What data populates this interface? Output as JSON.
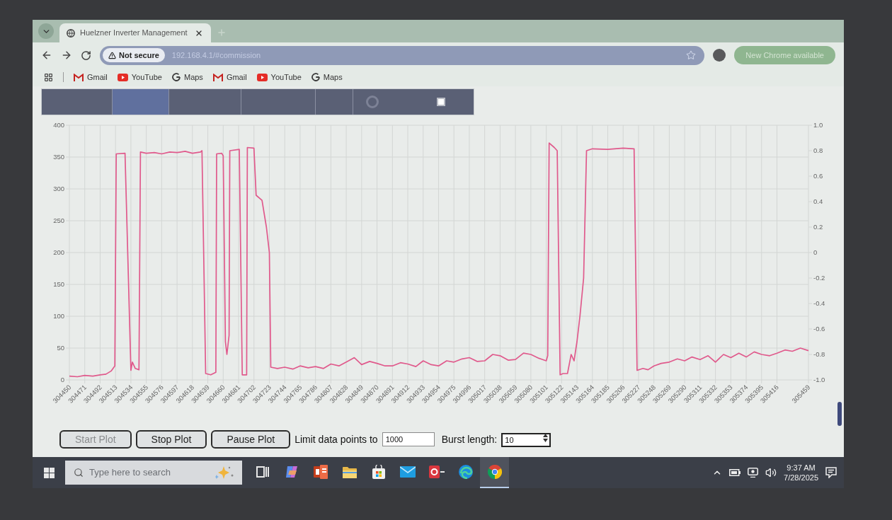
{
  "browser": {
    "tabs": [
      {
        "title": "Huelzner Inverter Management",
        "selected": true
      }
    ],
    "address_bar": {
      "security_label": "Not secure",
      "url": "192.168.4.1/#commission"
    },
    "update_button": "New Chrome available",
    "bookmarks": [
      {
        "kind": "gmail",
        "label": "Gmail"
      },
      {
        "kind": "youtube",
        "label": "YouTube"
      },
      {
        "kind": "google",
        "label": "Maps"
      },
      {
        "kind": "gmail",
        "label": "Gmail"
      },
      {
        "kind": "youtube",
        "label": "YouTube"
      },
      {
        "kind": "google",
        "label": "Maps"
      }
    ]
  },
  "app": {
    "nav_tabs": [
      {
        "kind": "plain",
        "selected": false
      },
      {
        "kind": "plain",
        "selected": true
      },
      {
        "kind": "plain",
        "selected": false
      },
      {
        "kind": "plain",
        "selected": false
      },
      {
        "kind": "plain",
        "selected": false
      },
      {
        "kind": "loading",
        "selected": false
      }
    ],
    "checkbox": {
      "checked": false
    },
    "chart_data": {
      "type": "line",
      "grid": true,
      "x": [
        304450,
        304461,
        304471,
        304482,
        304492,
        304500,
        304507,
        304512,
        304514,
        304526,
        304534,
        304536,
        304540,
        304545,
        304547,
        304555,
        304566,
        304576,
        304587,
        304597,
        304608,
        304618,
        304629,
        304631,
        304636,
        304643,
        304650,
        304651,
        304658,
        304660,
        304663,
        304665,
        304668,
        304669,
        304682,
        304686,
        304692,
        304693,
        304702,
        304705,
        304713,
        304719,
        304723,
        304725,
        304734,
        304744,
        304755,
        304765,
        304776,
        304786,
        304797,
        304807,
        304818,
        304828,
        304839,
        304849,
        304860,
        304870,
        304881,
        304891,
        304902,
        304912,
        304923,
        304933,
        304944,
        304954,
        304965,
        304975,
        304986,
        304996,
        305007,
        305017,
        305028,
        305038,
        305049,
        305059,
        305070,
        305080,
        305091,
        305101,
        305103,
        305105,
        305112,
        305116,
        305120,
        305124,
        305130,
        305135,
        305139,
        305143,
        305147,
        305152,
        305156,
        305164,
        305185,
        305206,
        305221,
        305225,
        305233,
        305240,
        305248,
        305258,
        305269,
        305280,
        305290,
        305300,
        305311,
        305322,
        305332,
        305343,
        305353,
        305364,
        305374,
        305385,
        305395,
        305406,
        305416,
        305427,
        305437,
        305448,
        305459
      ],
      "series": [
        {
          "color": "#e05a8c",
          "values": [
            6,
            5,
            7,
            6,
            8,
            9,
            14,
            22,
            355,
            356,
            15,
            28,
            18,
            16,
            358,
            356,
            357,
            355,
            358,
            357,
            359,
            356,
            358,
            360,
            10,
            8,
            12,
            355,
            356,
            352,
            60,
            40,
            70,
            360,
            362,
            8,
            8,
            365,
            364,
            290,
            282,
            240,
            200,
            20,
            18,
            20,
            17,
            22,
            19,
            21,
            18,
            25,
            22,
            28,
            35,
            24,
            29,
            26,
            22,
            22,
            27,
            25,
            21,
            30,
            24,
            22,
            30,
            28,
            33,
            35,
            29,
            30,
            40,
            38,
            31,
            32,
            42,
            40,
            34,
            30,
            38,
            372,
            365,
            360,
            8,
            10,
            10,
            40,
            30,
            60,
            100,
            160,
            360,
            363,
            362,
            364,
            363,
            15,
            18,
            16,
            22,
            26,
            28,
            33,
            30,
            36,
            32,
            38,
            28,
            40,
            35,
            42,
            36,
            44,
            40,
            38,
            42,
            47,
            45,
            50,
            46
          ]
        }
      ],
      "xlim": [
        304450,
        305459
      ],
      "ylim": [
        0,
        400
      ],
      "xticks": [
        304450,
        304471,
        304492,
        304513,
        304534,
        304555,
        304576,
        304597,
        304618,
        304639,
        304660,
        304681,
        304702,
        304723,
        304744,
        304765,
        304786,
        304807,
        304828,
        304849,
        304870,
        304891,
        304912,
        304933,
        304954,
        304975,
        304996,
        305017,
        305038,
        305059,
        305080,
        305101,
        305122,
        305143,
        305164,
        305185,
        305206,
        305227,
        305248,
        305269,
        305290,
        305311,
        305332,
        305353,
        305374,
        305395,
        305416,
        305459
      ],
      "yticks": [
        0,
        50,
        100,
        150,
        200,
        250,
        300,
        350,
        400
      ],
      "y2lim": [
        -1,
        1
      ],
      "y2ticks": [
        {
          "value": 1,
          "label": "1.0"
        },
        {
          "value": 0.8,
          "label": "0.8"
        },
        {
          "value": 0.6,
          "label": "0.6"
        },
        {
          "value": 0.4,
          "label": "0.4"
        },
        {
          "value": 0.2,
          "label": "0.2"
        },
        {
          "value": 0,
          "label": "0"
        },
        {
          "value": -0.2,
          "label": "-0.2"
        },
        {
          "value": -0.4,
          "label": "-0.4"
        },
        {
          "value": -0.6,
          "label": "-0.6"
        },
        {
          "value": -0.8,
          "label": "-0.8"
        },
        {
          "value": -1,
          "label": "-1.0"
        }
      ]
    },
    "buttons": [
      {
        "label": "Start Plot",
        "disabled": true
      },
      {
        "label": "Stop Plot",
        "disabled": false
      },
      {
        "label": "Pause Plot",
        "disabled": false
      }
    ],
    "limit_field": {
      "label": "Limit data points to",
      "value": "1000"
    },
    "burst_field": {
      "label": "Burst length:",
      "value": "10"
    }
  },
  "taskbar": {
    "search": {
      "placeholder": "Type here to search"
    },
    "apps": [
      {
        "kind": "taskview",
        "active": false
      },
      {
        "kind": "copilot",
        "active": false
      },
      {
        "kind": "powerpoint",
        "active": false
      },
      {
        "kind": "explorer",
        "active": false
      },
      {
        "kind": "store",
        "active": false
      },
      {
        "kind": "mail",
        "active": false
      },
      {
        "kind": "redtile",
        "active": false
      },
      {
        "kind": "edge",
        "active": false
      },
      {
        "kind": "chrome",
        "active": true
      }
    ],
    "clock": {
      "time": "9:37 AM",
      "date": "7/28/2025"
    }
  }
}
